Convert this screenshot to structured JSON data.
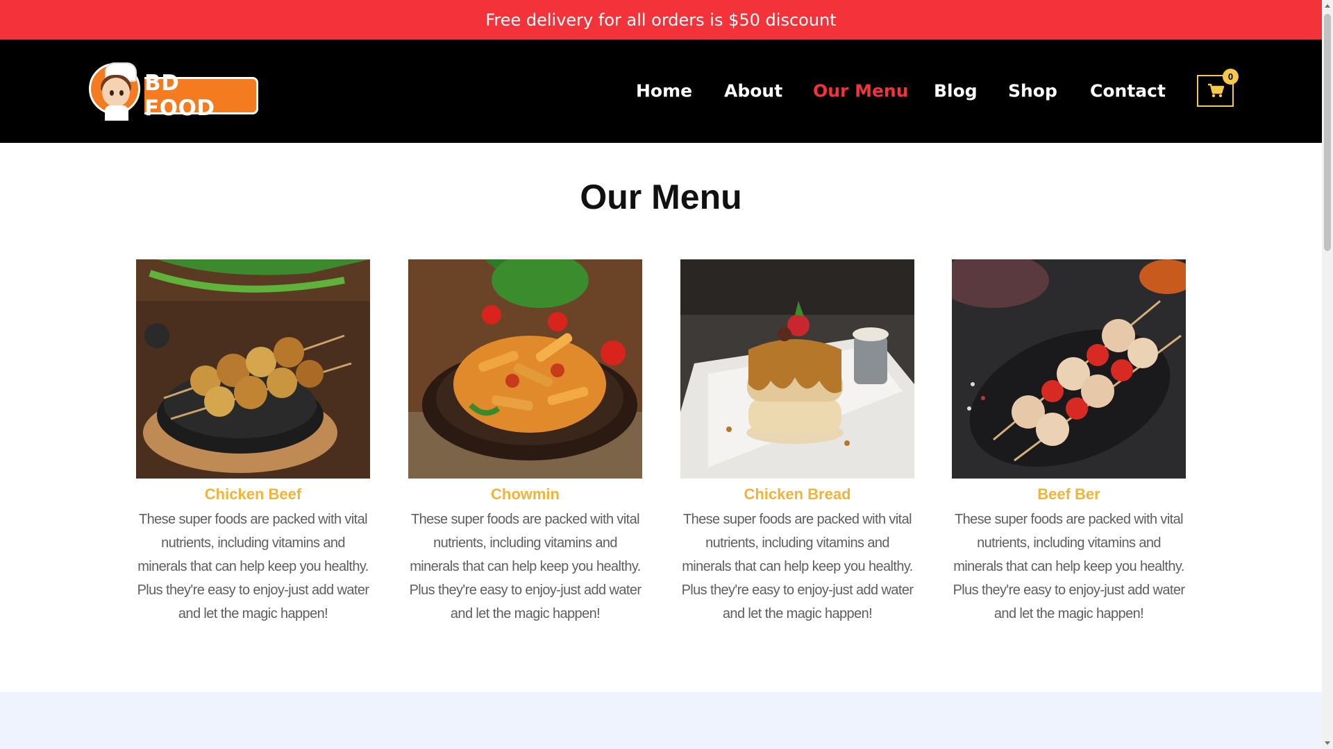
{
  "promo": {
    "text": "Free delivery for all orders is $50 discount"
  },
  "logo": {
    "text": "BD FOOD"
  },
  "nav": {
    "items": [
      {
        "label": "Home",
        "active": false
      },
      {
        "label": "About",
        "active": false
      },
      {
        "label": "Our Menu",
        "active": true
      },
      {
        "label": "Blog",
        "active": false
      },
      {
        "label": "Shop",
        "active": false
      },
      {
        "label": "Contact",
        "active": false
      }
    ],
    "cart_count": "0",
    "active_color": "#f3323a"
  },
  "menu": {
    "title": "Our Menu",
    "items": [
      {
        "name": "Chicken Beef",
        "image": "chicken-skewers-photo",
        "description": "These super foods are packed with vital nutrients, including vitamins and minerals that can help keep you healthy. Plus they're easy to enjoy-just add water and let the magic happen!"
      },
      {
        "name": "Chowmin",
        "image": "penne-pasta-photo",
        "description": "These super foods are packed with vital nutrients, including vitamins and minerals that can help keep you healthy. Plus they're easy to enjoy-just add water and let the magic happen!"
      },
      {
        "name": "Chicken Bread",
        "image": "pancake-stack-photo",
        "description": "These super foods are packed with vital nutrients, including vitamins and minerals that can help keep you healthy. Plus they're easy to enjoy-just add water and let the magic happen!"
      },
      {
        "name": "Beef Ber",
        "image": "chicken-kebab-photo",
        "description": "These super foods are packed with vital nutrients, including vitamins and minerals that can help keep you healthy. Plus they're easy to enjoy-just add water and let the magic happen!"
      }
    ]
  },
  "colors": {
    "promo_bg": "#f3323a",
    "header_bg": "#000000",
    "item_name": "#f0b43a",
    "cart_accent": "#f7c948"
  }
}
